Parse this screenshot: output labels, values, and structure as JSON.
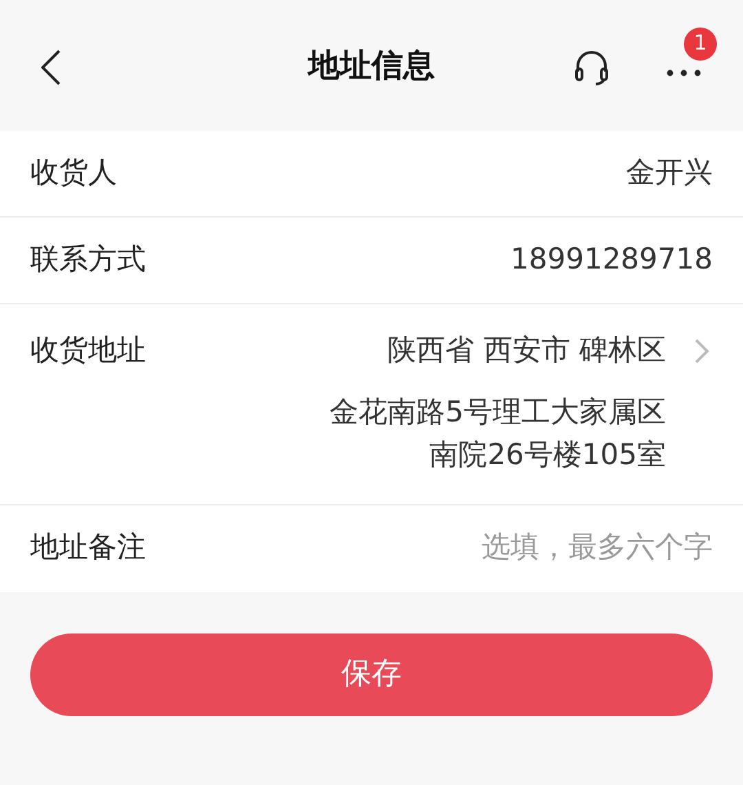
{
  "header": {
    "title": "地址信息",
    "badge": "1"
  },
  "fields": [
    {
      "kind": "text",
      "label": "收货人",
      "value": "金开兴"
    },
    {
      "kind": "text",
      "label": "联系方式",
      "value": "18991289718"
    },
    {
      "kind": "region",
      "label": "收货地址",
      "value": "陕西省 西安市 碑林区",
      "detail": [
        "金花南路5号理工大家属区",
        "南院26号楼105室"
      ]
    },
    {
      "kind": "input",
      "label": "地址备注",
      "placeholder": "选填，最多六个字"
    }
  ],
  "save_button": "保存"
}
